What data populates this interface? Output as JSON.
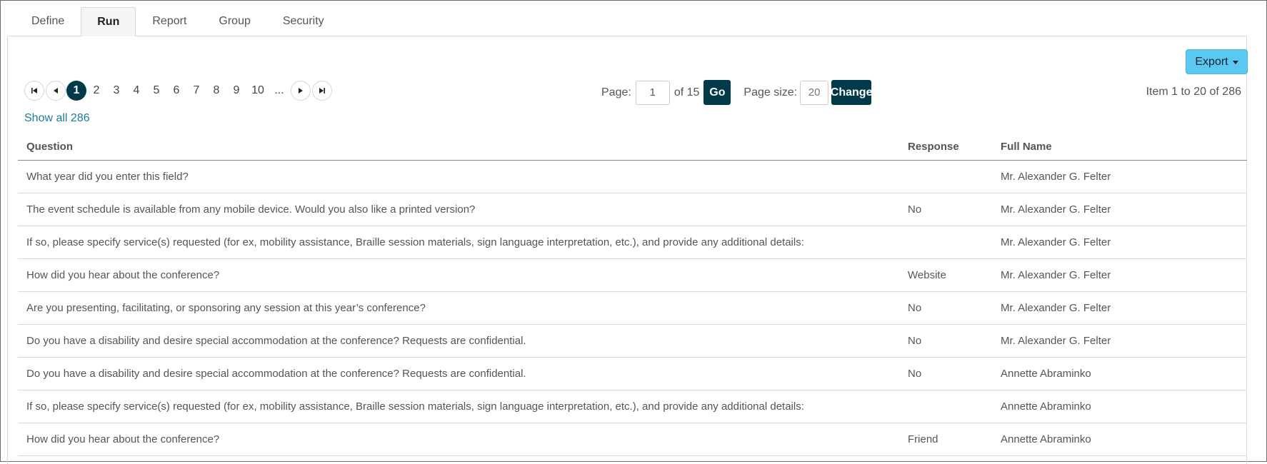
{
  "tabs": [
    "Define",
    "Run",
    "Report",
    "Group",
    "Security"
  ],
  "active_tab": "Run",
  "export_label": "Export",
  "pager": {
    "pages": [
      "1",
      "2",
      "3",
      "4",
      "5",
      "6",
      "7",
      "8",
      "9",
      "10"
    ],
    "current": "1",
    "ellipsis": "..."
  },
  "page_control": {
    "page_label": "Page:",
    "page_value": "1",
    "of_label": "of 15",
    "go_label": "Go",
    "size_label": "Page size:",
    "size_value": "20",
    "change_label": "Change"
  },
  "item_range": "Item 1 to 20 of 286",
  "show_all": "Show all 286",
  "table": {
    "headers": [
      "Question",
      "Response",
      "Full Name"
    ],
    "rows": [
      {
        "question": "What year did you enter this field?",
        "response": "",
        "name": "Mr. Alexander G. Felter"
      },
      {
        "question": "The event schedule is available from any mobile device. Would you also like a printed version?",
        "response": "No",
        "name": "Mr. Alexander G. Felter"
      },
      {
        "question": "If so, please specify service(s) requested (for ex, mobility assistance, Braille session materials, sign language interpretation, etc.), and provide any additional details:",
        "response": "",
        "name": "Mr. Alexander G. Felter"
      },
      {
        "question": "How did you hear about the conference?",
        "response": "Website",
        "name": "Mr. Alexander G. Felter"
      },
      {
        "question": "Are you presenting, facilitating, or sponsoring any session at this year’s conference?",
        "response": "No",
        "name": "Mr. Alexander G. Felter"
      },
      {
        "question": "Do you have a disability and desire special accommodation at the conference? Requests are confidential.",
        "response": "No",
        "name": "Mr. Alexander G. Felter"
      },
      {
        "question": "Do you have a disability and desire special accommodation at the conference? Requests are confidential.",
        "response": "No",
        "name": "Annette Abraminko"
      },
      {
        "question": "If so, please specify service(s) requested (for ex, mobility assistance, Braille session materials, sign language interpretation, etc.), and provide any additional details:",
        "response": "",
        "name": "Annette Abraminko"
      },
      {
        "question": "How did you hear about the conference?",
        "response": "Friend",
        "name": "Annette Abraminko"
      }
    ]
  }
}
